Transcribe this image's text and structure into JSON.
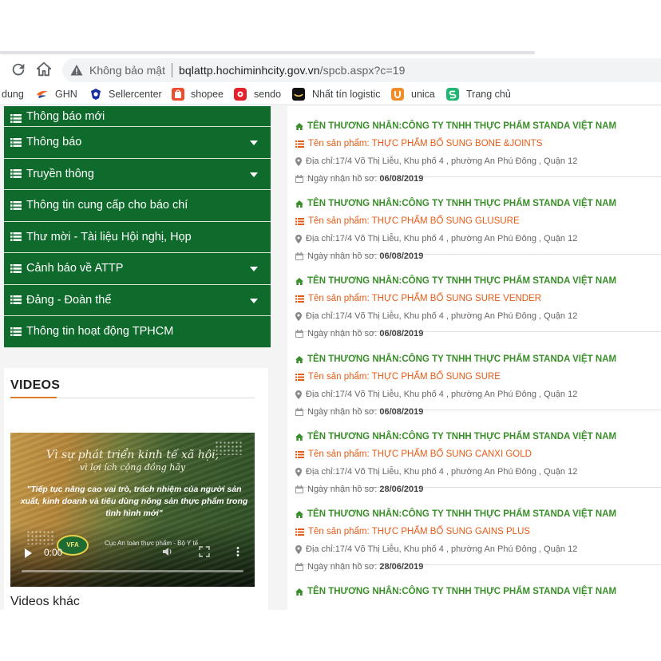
{
  "browser": {
    "security_label": "Không bảo mật",
    "url_host": "bqlattp.hochiminhcity.gov.vn",
    "url_path": "/spcb.aspx?c=19"
  },
  "bookmarks": [
    {
      "label": "dung",
      "icon": "bookmark-icon",
      "color": "#ffffff"
    },
    {
      "label": "GHN",
      "icon": "ghn-icon",
      "color": "#f26522"
    },
    {
      "label": "Sellercenter",
      "icon": "sellercenter-icon",
      "color": "#1a2fa0"
    },
    {
      "label": "shopee",
      "icon": "shopee-icon",
      "color": "#ee4d2d"
    },
    {
      "label": "sendo",
      "icon": "sendo-icon",
      "color": "#e3222d"
    },
    {
      "label": "Nhất tín logistic",
      "icon": "nhattin-icon",
      "color": "#111111"
    },
    {
      "label": "unica",
      "icon": "unica-icon",
      "color": "#f28c28"
    },
    {
      "label": "Trang chủ",
      "icon": "home-s-icon",
      "color": "#21b573"
    }
  ],
  "menu": {
    "items": [
      {
        "label": "Thông báo mới",
        "has_dropdown": false
      },
      {
        "label": "Thông báo",
        "has_dropdown": true
      },
      {
        "label": "Truyền thông",
        "has_dropdown": true
      },
      {
        "label": "Thông tin cung cấp cho báo chí",
        "has_dropdown": false
      },
      {
        "label": "Thư mời - Tài liệu Hội nghị, Họp",
        "has_dropdown": false
      },
      {
        "label": "Cảnh báo về ATTP",
        "has_dropdown": true
      },
      {
        "label": "Đảng - Đoàn thể",
        "has_dropdown": true
      },
      {
        "label": "Thông tin hoạt động TPHCM",
        "has_dropdown": false
      }
    ],
    "color": "#0f6b2c"
  },
  "videos": {
    "title": "VIDEOS",
    "video": {
      "script_line1": "Vì sự phát triển kinh tế xã hội,",
      "script_line2": "vì lợi ích cộng đồng hãy",
      "quote": "\"Tiếp tục nâng cao vai trò, trách nhiệm của người sản xuất, kinh doanh và tiêu dùng nông sản thực phẩm trong tình hình mới\"",
      "logo_text": "VFA",
      "credit": "Cục An toàn thực phẩm - Bộ Y tế",
      "time": "0:00"
    },
    "more_label": "Videos khác"
  },
  "products": {
    "merchant_prefix": "TÊN THƯƠNG NHÂN: ",
    "name_prefix": "Tên sản phẩm: ",
    "address_prefix": "Địa chỉ: ",
    "date_prefix": "Ngày nhận hồ sơ: ",
    "items": [
      {
        "merchant": "CÔNG TY TNHH THỰC PHẨM STANDA VIỆT NAM",
        "name": "THỰC PHẨM BỔ SUNG BONE &JOINTS",
        "address": "17/4 Võ Thị Liễu, Khu phố 4 , phường An Phú Đông , Quận 12",
        "date": "06/08/2019"
      },
      {
        "merchant": "CÔNG TY TNHH THỰC PHẨM STANDA VIỆT NAM",
        "name": "THỰC PHẨM BỔ SUNG GLUSURE",
        "address": "17/4 Võ Thị Liễu, Khu phố 4 , phường An Phú Đông , Quận 12",
        "date": "06/08/2019"
      },
      {
        "merchant": "CÔNG TY TNHH THỰC PHẨM STANDA VIỆT NAM",
        "name": "THỰC PHẨM BỔ SUNG SURE VENDER",
        "address": "17/4 Võ Thị Liễu, Khu phố 4 , phường An Phú Đông , Quận 12",
        "date": "06/08/2019"
      },
      {
        "merchant": "CÔNG TY TNHH THỰC PHẨM STANDA VIỆT NAM",
        "name": "THỰC PHẨM BỔ SUNG SURE",
        "address": "17/4 Võ Thị Liễu, Khu phố 4 , phường An Phú Đông , Quận 12",
        "date": "06/08/2019"
      },
      {
        "merchant": "CÔNG TY TNHH THỰC PHẨM STANDA VIỆT NAM",
        "name": "THỰC PHẨM BỔ SUNG CANXI GOLD",
        "address": "17/4 Võ Thị Liễu, Khu phố 4 , phường An Phú Đông , Quận 12",
        "date": "28/06/2019"
      },
      {
        "merchant": "CÔNG TY TNHH THỰC PHẨM STANDA VIỆT NAM",
        "name": "THỰC PHẨM BỔ SUNG GAINS PLUS",
        "address": "17/4 Võ Thị Liễu, Khu phố 4 , phường An Phú Đông , Quận 12",
        "date": "28/06/2019"
      },
      {
        "merchant": "CÔNG TY TNHH THỰC PHẨM STANDA VIỆT NAM",
        "name": "",
        "address": "",
        "date": ""
      }
    ],
    "merchant_color": "#3a8f2a",
    "name_color": "#e85b17"
  }
}
